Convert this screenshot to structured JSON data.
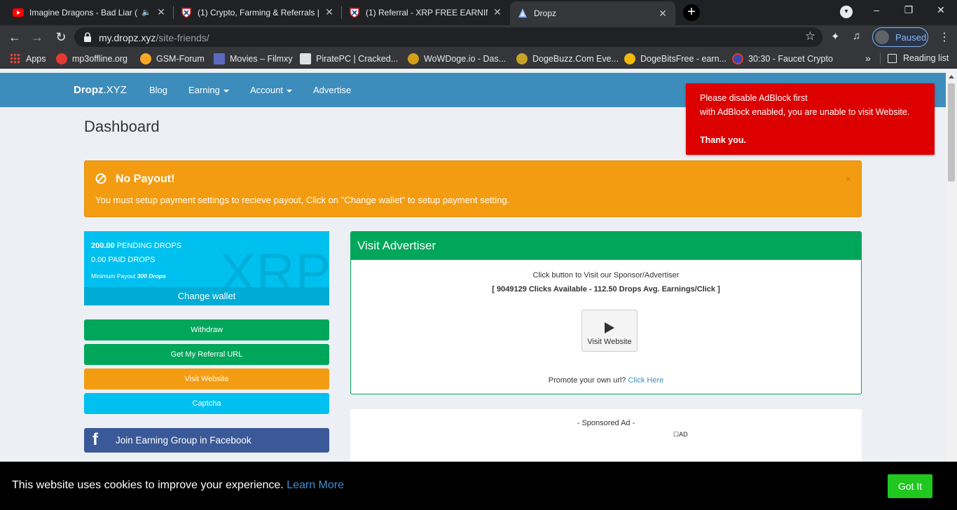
{
  "browser": {
    "tabs": [
      {
        "title": "Imagine Dragons - Bad Liar (",
        "active": false
      },
      {
        "title": "(1) Crypto, Farming & Referrals |",
        "active": false
      },
      {
        "title": "(1) Referral - XRP FREE EARNING",
        "active": false
      },
      {
        "title": "Dropz",
        "active": true
      }
    ],
    "new_tab": "+",
    "url_host": "my.dropz.xyz",
    "url_path": "/site-friends/",
    "profile_status": "Paused",
    "window_controls": {
      "minimize": "–",
      "restore": "❐",
      "close": "✕"
    }
  },
  "bookmarks": {
    "items": [
      {
        "label": "Apps",
        "icon": "apps-grid-icon"
      },
      {
        "label": "mp3offline.org",
        "icon": "mp3offline-icon"
      },
      {
        "label": "GSM-Forum",
        "icon": "gsm-forum-icon"
      },
      {
        "label": "Movies – Filmxy",
        "icon": "filmxy-icon"
      },
      {
        "label": "PiratePC | Cracked...",
        "icon": "piratepc-icon"
      },
      {
        "label": "WoWDoge.io - Das...",
        "icon": "wowdoge-icon"
      },
      {
        "label": "DogeBuzz.Com Eve...",
        "icon": "dogebuzz-icon"
      },
      {
        "label": "DogeBitsFree - earn...",
        "icon": "dogebitsfree-icon"
      },
      {
        "label": "30:30 - Faucet Crypto",
        "icon": "faucetcrypto-icon"
      }
    ],
    "more": "»",
    "reading_list": "Reading list"
  },
  "site": {
    "brand_bold": "Dropz",
    "brand_light": ".XYZ",
    "nav": {
      "blog": "Blog",
      "earning": "Earning",
      "account": "Account",
      "advertise": "Advertise"
    }
  },
  "page_title": "Dashboard",
  "alert": {
    "title": "No Payout!",
    "message": "You must setup payment settings to recieve payout, Click on \"Change wallet\" to setup payment setting.",
    "close": "×"
  },
  "wallet": {
    "pending_amount": "200.00",
    "pending_label": "PENDING DROPS",
    "paid_line": "0.00 PAID DROPS",
    "min_label": "Minimum Payout",
    "min_value": "300 Drops",
    "watermark": "XRP",
    "change_wallet": "Change wallet"
  },
  "side_buttons": {
    "withdraw": "Withdraw",
    "referral": "Get My Referral URL",
    "visit": "Visit Website",
    "captcha": "Captcha"
  },
  "facebook": {
    "letter": "f",
    "label": "Join Earning Group in Facebook"
  },
  "visit_advertiser": {
    "header": "Visit Advertiser",
    "desc": "Click button to Visit our Sponsor/Advertiser",
    "stats": "[ 9049129 Clicks Available - 112.50 Drops Avg. Earnings/Click ]",
    "button": "Visit Website",
    "promo_text": "Promote your own url?",
    "promo_link": "Click Here"
  },
  "sponsored": {
    "label": "- Sponsored Ad -",
    "ad_tag": "AD"
  },
  "adblock_notice": {
    "line1": "Please disable AdBlock first",
    "line2": "with AdBlock enabled, you are unable to visit Website.",
    "line3": "Thank you."
  },
  "cookie": {
    "text": "This website uses cookies to improve your experience.",
    "learn_more": "Learn More",
    "button": "Got It"
  },
  "colors": {
    "nav_blue": "#3c8dbc",
    "warning": "#f39c12",
    "info": "#00c0ef",
    "success": "#00a65a",
    "facebook": "#3b5998",
    "adblock_red": "#dd0000",
    "cookie_btn": "#1fc71f"
  }
}
